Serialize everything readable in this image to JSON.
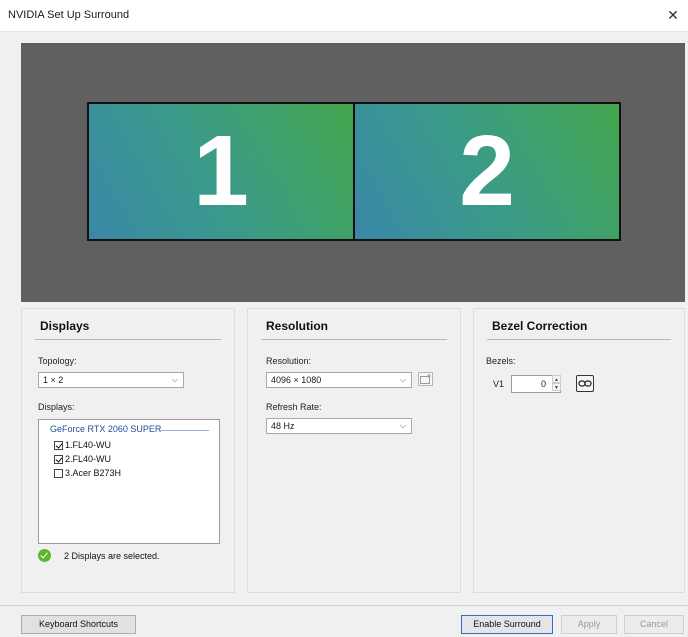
{
  "window": {
    "title": "NVIDIA Set Up Surround",
    "close_label": "✕"
  },
  "preview": {
    "monitors": [
      "1",
      "2"
    ],
    "background": "#606060",
    "monitor_gradient": [
      "#3a87a8",
      "#44a64e"
    ]
  },
  "displays_panel": {
    "title": "Displays",
    "topology_label": "Topology:",
    "topology_value": "1 × 2",
    "displays_label": "Displays:",
    "gpu_name": "GeForce RTX 2060 SUPER",
    "displays": [
      {
        "label": "1.FL40-WU",
        "checked": true
      },
      {
        "label": "2.FL40-WU",
        "checked": true
      },
      {
        "label": "3.Acer B273H",
        "checked": false
      }
    ],
    "status_text": "2 Displays are selected."
  },
  "resolution_panel": {
    "title": "Resolution",
    "resolution_label": "Resolution:",
    "resolution_value": "4096 × 1080",
    "refresh_label": "Refresh Rate:",
    "refresh_value": "48 Hz"
  },
  "bezel_panel": {
    "title": "Bezel Correction",
    "bezels_label": "Bezels:",
    "v1_label": "V1",
    "v1_value": "0"
  },
  "footer": {
    "keyboard_shortcuts": "Keyboard Shortcuts",
    "enable_surround": "Enable Surround",
    "apply": "Apply",
    "cancel": "Cancel"
  },
  "colors": {
    "accent": "#2a6fc9",
    "ok_green": "#5fb52e",
    "gpu_link": "#1f4e9a"
  }
}
